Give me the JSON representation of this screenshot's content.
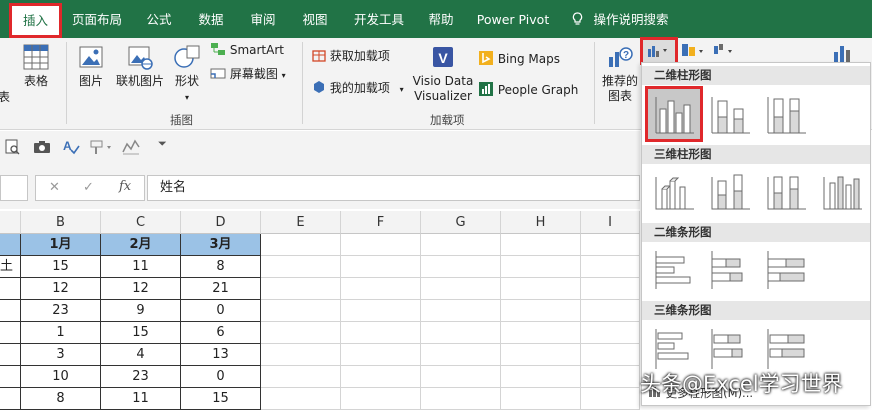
{
  "menubar": {
    "tabs": [
      "插入",
      "页面布局",
      "公式",
      "数据",
      "审阅",
      "视图",
      "开发工具",
      "帮助",
      "Power Pivot",
      "操作说明搜索"
    ]
  },
  "ribbon": {
    "partial_left": "表",
    "table_label": "表格",
    "picture_label": "图片",
    "online_picture_label": "联机图片",
    "shapes_label": "形状",
    "smartart_label": "SmartArt",
    "screenshot_label": "屏幕截图",
    "illustrations_group": "插图",
    "get_addins_label": "获取加载项",
    "my_addins_label": "我的加载项",
    "visio_label_1": "Visio Data",
    "visio_label_2": "Visualizer",
    "bing_maps_label": "Bing Maps",
    "people_graph_label": "People Graph",
    "addins_group": "加载项",
    "recommended_charts_1": "推荐的",
    "recommended_charts_2": "图表"
  },
  "formula_bar": {
    "cancel": "✕",
    "confirm": "✓",
    "fx": "fx",
    "content": "姓名"
  },
  "grid": {
    "columns": [
      "B",
      "C",
      "D",
      "E",
      "F",
      "G",
      "H",
      "I"
    ],
    "header_row": [
      "1月",
      "2月",
      "3月"
    ],
    "partial_first_col": "土",
    "rows": [
      [
        "15",
        "11",
        "8"
      ],
      [
        "12",
        "12",
        "21"
      ],
      [
        "23",
        "9",
        "0"
      ],
      [
        "1",
        "15",
        "6"
      ],
      [
        "3",
        "4",
        "13"
      ],
      [
        "10",
        "23",
        "0"
      ],
      [
        "8",
        "11",
        "15"
      ]
    ]
  },
  "dropdown": {
    "sections": [
      "二维柱形图",
      "三维柱形图",
      "二维条形图",
      "三维条形图"
    ],
    "footer": "更多柱形图(M)..."
  },
  "watermark": "头条@Excel学习世界",
  "colors": {
    "accent": "#217346",
    "header_fill": "#9bc2e6",
    "highlight": "#e0282b"
  }
}
